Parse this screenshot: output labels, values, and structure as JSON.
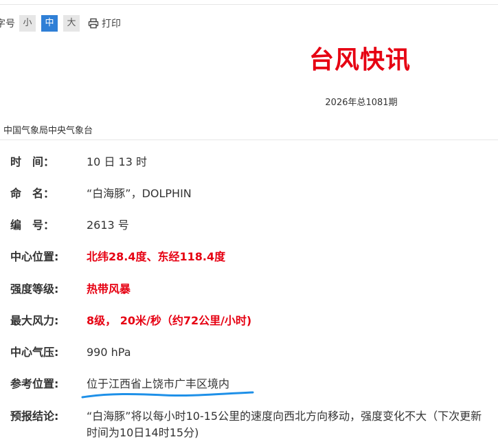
{
  "toolbar": {
    "font_label": "字号",
    "sizes": [
      "小",
      "中",
      "大"
    ],
    "print_label": "打印"
  },
  "header": {
    "title": "台风快讯",
    "issue": "2026年总1081期",
    "agency": "中国气象局中央气象台"
  },
  "rows": [
    {
      "label": "时　间：",
      "value": "10 日 13 时"
    },
    {
      "label": "命　名：",
      "value": "“白海豚”，DOLPHIN"
    },
    {
      "label": "编　号：",
      "value": "2613 号"
    },
    {
      "label": "中心位置:",
      "value": "北纬28.4度、东经118.4度"
    },
    {
      "label": "强度等级:",
      "value": "热带风暴"
    },
    {
      "label": "最大风力:",
      "value": "8级， 20米/秒（约72公里/小时)"
    },
    {
      "label": "中心气压:",
      "value": "990 hPa"
    },
    {
      "label": "参考位置:",
      "value": "位于江西省上饶市广丰区境内"
    },
    {
      "label": "预报结论:",
      "value": "“白海豚”将以每小时10-15公里的速度向西北方向移动，强度变化不大（下次更新时间为10日14时15分)"
    }
  ],
  "colors": {
    "title_red": "#e60012",
    "active_size_blue": "#2f7fd6",
    "annotation_blue": "#1e90e8"
  },
  "icons": {
    "print": "printer-icon"
  }
}
